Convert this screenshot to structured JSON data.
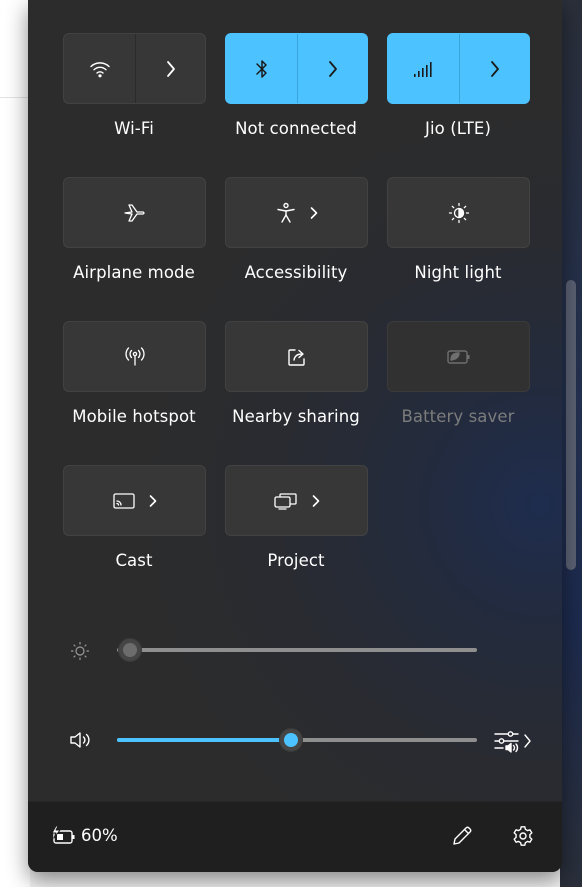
{
  "quick_settings": {
    "tiles": [
      {
        "label": "Wi-Fi",
        "icon": "wifi-icon",
        "has_chevron": true,
        "state": "off"
      },
      {
        "label": "Not connected",
        "icon": "bluetooth-icon",
        "has_chevron": true,
        "state": "on"
      },
      {
        "label": "Jio (LTE)",
        "icon": "cellular-icon",
        "has_chevron": true,
        "state": "on"
      },
      {
        "label": "Airplane mode",
        "icon": "airplane-icon",
        "has_chevron": false,
        "state": "off"
      },
      {
        "label": "Accessibility",
        "icon": "accessibility-icon",
        "has_chevron": true,
        "state": "off"
      },
      {
        "label": "Night light",
        "icon": "night-light-icon",
        "has_chevron": false,
        "state": "off"
      },
      {
        "label": "Mobile hotspot",
        "icon": "hotspot-icon",
        "has_chevron": false,
        "state": "off"
      },
      {
        "label": "Nearby sharing",
        "icon": "share-icon",
        "has_chevron": false,
        "state": "off"
      },
      {
        "label": "Battery saver",
        "icon": "battery-saver-icon",
        "has_chevron": false,
        "state": "disabled"
      },
      {
        "label": "Cast",
        "icon": "cast-icon",
        "has_chevron": true,
        "state": "off"
      },
      {
        "label": "Project",
        "icon": "project-icon",
        "has_chevron": true,
        "state": "off"
      }
    ]
  },
  "sliders": {
    "brightness": {
      "icon": "brightness-icon",
      "value": 0.04
    },
    "volume": {
      "icon": "speaker-icon",
      "value": 0.48,
      "mixer_icon": "audio-mixer-icon"
    }
  },
  "footer": {
    "battery_icon": "battery-charging-icon",
    "battery_percent": "60%",
    "edit_icon": "pencil-icon",
    "settings_icon": "gear-icon"
  },
  "colors": {
    "accent": "#4cc2ff",
    "panel": "#2c2c2c",
    "tile": "#373737",
    "footer": "#1f1f1f"
  }
}
